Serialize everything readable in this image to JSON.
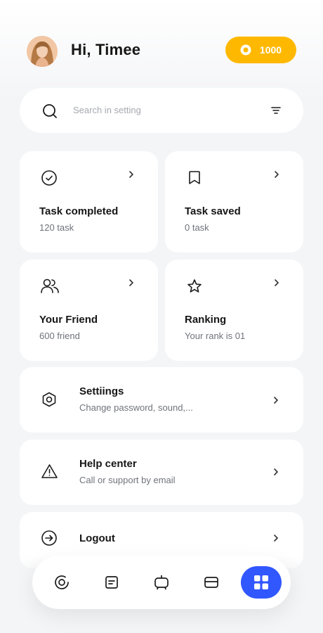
{
  "header": {
    "greeting": "Hi, Timee",
    "coins": "1000"
  },
  "search": {
    "placeholder": "Search in setting"
  },
  "tiles": [
    {
      "title": "Task completed",
      "subtitle": "120 task",
      "icon": "check-circle-icon"
    },
    {
      "title": "Task saved",
      "subtitle": "0 task",
      "icon": "bookmark-icon"
    },
    {
      "title": "Your Friend",
      "subtitle": "600 friend",
      "icon": "users-icon"
    },
    {
      "title": "Ranking",
      "subtitle": "Your rank is 01",
      "icon": "star-icon"
    }
  ],
  "menu": [
    {
      "title": "Settiings",
      "subtitle": "Change password, sound,...",
      "icon": "hexagon-gear-icon"
    },
    {
      "title": "Help center",
      "subtitle": "Call or support by email",
      "icon": "warning-icon"
    },
    {
      "title": "Logout",
      "subtitle": "",
      "icon": "arrow-right-circle-icon"
    }
  ],
  "bottom_nav": {
    "items": [
      "target-icon",
      "note-icon",
      "tv-icon",
      "card-icon",
      "grid-icon"
    ],
    "active_index": 4
  },
  "colors": {
    "accent": "#3157ff",
    "coin": "#ffb800",
    "background": "#f4f5f7"
  }
}
